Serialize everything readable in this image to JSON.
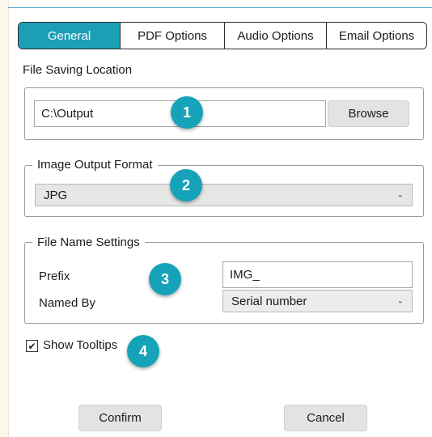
{
  "colors": {
    "accent": "#1c9fb6",
    "badge": "#16a3b9"
  },
  "tabs": [
    {
      "label": "General",
      "active": true
    },
    {
      "label": "PDF Options",
      "active": false
    },
    {
      "label": "Audio Options",
      "active": false
    },
    {
      "label": "Email Options",
      "active": false
    }
  ],
  "file_saving": {
    "section_label": "File Saving Location",
    "path_value": "C:\\Output",
    "browse_label": "Browse"
  },
  "image_output": {
    "title": "Image Output Format",
    "selected": "JPG"
  },
  "file_name_settings": {
    "title": "File Name Settings",
    "prefix_label": "Prefix",
    "prefix_value": "IMG_",
    "named_by_label": "Named By",
    "named_by_selected": "Serial number"
  },
  "show_tooltips": {
    "label": "Show Tooltips",
    "checked": true,
    "check_glyph": "✔"
  },
  "badges": [
    "1",
    "2",
    "3",
    "4"
  ],
  "footer": {
    "confirm_label": "Confirm",
    "cancel_label": "Cancel"
  },
  "icons": {
    "chevron": "chevron-down-icon"
  }
}
